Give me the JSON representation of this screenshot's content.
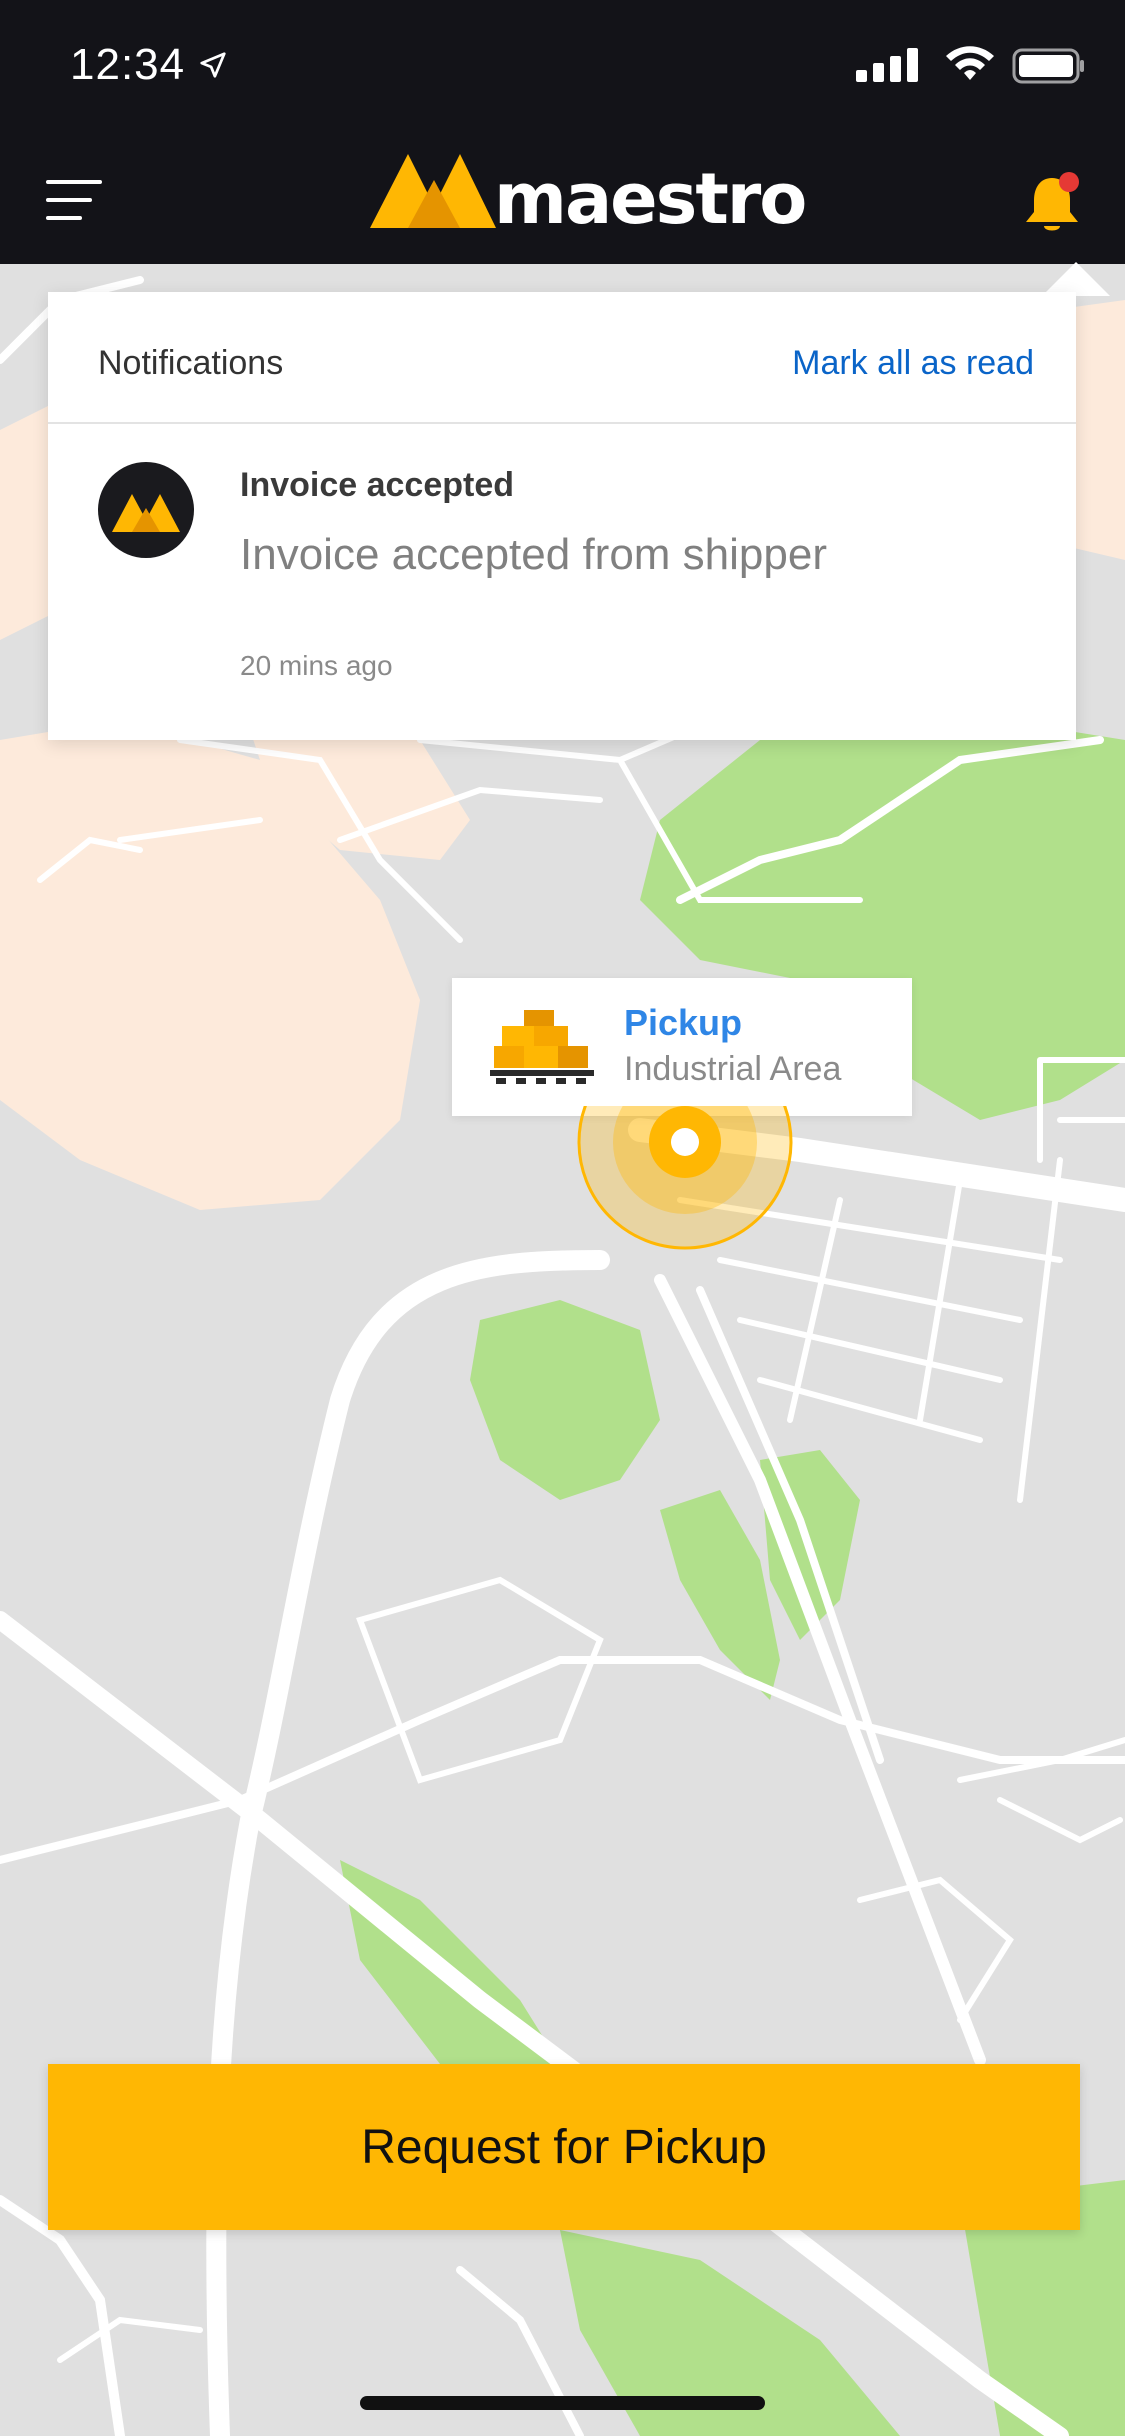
{
  "status_bar": {
    "time": "12:34",
    "icons": [
      "location-arrow-icon",
      "signal-icon",
      "wifi-icon",
      "battery-icon"
    ]
  },
  "navbar": {
    "app_name": "maestro",
    "menu_icon": "hamburger-menu-icon",
    "notification_icon": "bell-icon",
    "has_unread_badge": true
  },
  "notifications": {
    "title": "Notifications",
    "mark_all_label": "Mark all as read",
    "items": [
      {
        "heading": "Invoice accepted",
        "body": "Invoice accepted from shipper",
        "time": "20 mins ago",
        "avatar": "maestro-logo-icon"
      }
    ]
  },
  "map": {
    "pickup_title": "Pickup",
    "pickup_location": "Industrial Area",
    "marker_icon": "pickup-pin-icon"
  },
  "actions": {
    "request_label": "Request for Pickup"
  },
  "colors": {
    "brand_yellow": "#ffb703",
    "dark": "#131318",
    "link_blue": "#0a64c8",
    "pickup_blue": "#2f86e6",
    "park_green": "#b1e08b",
    "area_beige": "#fdeadb",
    "badge_red": "#e53935"
  }
}
